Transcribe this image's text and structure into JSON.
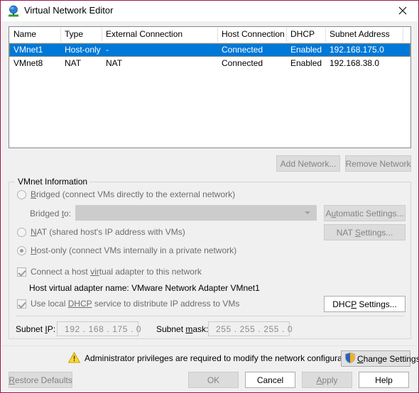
{
  "window": {
    "title": "Virtual Network Editor",
    "icon": "vmware-network-icon",
    "close_label": "close-icon",
    "border_color": "#9b1750",
    "accent_selection_color": "#0078d7"
  },
  "network_table": {
    "columns": [
      "Name",
      "Type",
      "External Connection",
      "Host Connection",
      "DHCP",
      "Subnet Address"
    ],
    "rows": [
      {
        "name": "VMnet1",
        "type": "Host-only",
        "external_connection": "-",
        "host_connection": "Connected",
        "dhcp": "Enabled",
        "subnet_address": "192.168.175.0",
        "selected": true
      },
      {
        "name": "VMnet8",
        "type": "NAT",
        "external_connection": "NAT",
        "host_connection": "Connected",
        "dhcp": "Enabled",
        "subnet_address": "192.168.38.0",
        "selected": false
      }
    ]
  },
  "table_buttons": {
    "add_network": "Add Network...",
    "remove_network": "Remove Network"
  },
  "vmnet_information": {
    "group_title": "VMnet Information",
    "bridged": {
      "label_prefix": "",
      "label_mnemonic": "B",
      "label_suffix": "ridged (connect VMs directly to the external network)",
      "checked": false
    },
    "bridged_to": {
      "label_prefix": "Bridged ",
      "label_mnemonic": "t",
      "label_suffix": "o:",
      "value": ""
    },
    "automatic_settings": {
      "prefix": "A",
      "mnemonic": "u",
      "suffix": "tomatic Settings..."
    },
    "nat": {
      "label_mnemonic": "N",
      "label_suffix": "AT (shared host's IP address with VMs)",
      "checked": false
    },
    "nat_settings": {
      "prefix": "NAT ",
      "mnemonic": "S",
      "suffix": "ettings..."
    },
    "host_only": {
      "label_prefix": "",
      "label_mnemonic": "H",
      "label_suffix": "ost-only (connect VMs internally in a private network)",
      "checked": true
    },
    "connect_host_adapter": {
      "prefix": "Connect a host ",
      "mnemonic": "vir",
      "suffix": "tual adapter to this network",
      "checked": true
    },
    "host_adapter_name": "Host virtual adapter name: VMware Network Adapter VMnet1",
    "use_local_dhcp": {
      "prefix": "Use local ",
      "mnemonic": "DHCP",
      "suffix": " service to distribute IP address to VMs",
      "checked": true
    },
    "dhcp_settings": {
      "prefix": "DHC",
      "mnemonic": "P",
      "suffix": " Settings..."
    },
    "subnet_ip": {
      "label_prefix": "Subnet ",
      "label_mnemonic": "I",
      "label_suffix": "P:",
      "value": "192 . 168 . 175 .  0"
    },
    "subnet_mask": {
      "label_prefix": "Subnet ",
      "label_mnemonic": "m",
      "label_suffix": "ask:",
      "value": "255 . 255 . 255 .  0"
    }
  },
  "notice": {
    "icon": "warning-triangle-icon",
    "text": "Administrator privileges are required to modify the network configuration.",
    "change_settings": {
      "icon": "uac-shield-icon",
      "prefix": "",
      "mnemonic": "C",
      "suffix": "hange Settings"
    }
  },
  "footer_buttons": {
    "restore_defaults": {
      "prefix": "",
      "mnemonic": "R",
      "suffix": "estore Defaults",
      "enabled": false
    },
    "ok": {
      "label": "OK",
      "enabled": false
    },
    "cancel": {
      "label": "Cancel",
      "enabled": true
    },
    "apply": {
      "prefix": "",
      "mnemonic": "A",
      "suffix": "pply",
      "enabled": false
    },
    "help": {
      "label": "Help",
      "enabled": true
    }
  }
}
